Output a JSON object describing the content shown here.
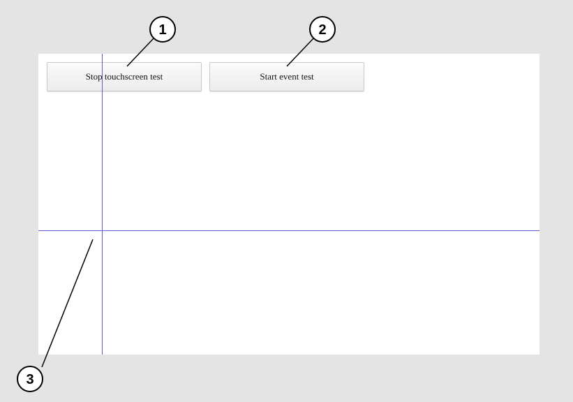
{
  "buttons": {
    "stop_touchscreen_test": "Stop touchscreen test",
    "start_event_test": "Start event test"
  },
  "callouts": {
    "one": "1",
    "two": "2",
    "three": "3"
  },
  "colors": {
    "crosshair": "#5b5bd6",
    "frame_background": "#e4e4e4",
    "screen_background": "#ffffff"
  }
}
